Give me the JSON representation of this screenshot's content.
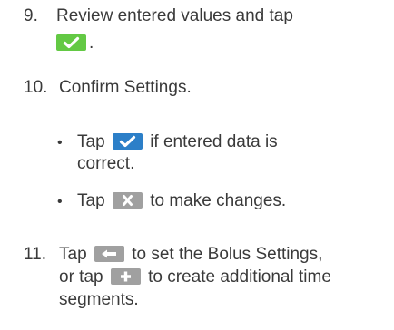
{
  "steps": [
    {
      "number": "9.",
      "line1": "Review entered values and tap",
      "after_icon": ".",
      "icon": "green-checkmark-icon"
    },
    {
      "number": "10.",
      "text": "Confirm Settings.",
      "bullets": [
        {
          "bullet": "•",
          "before_icon": "Tap",
          "icon": "blue-checkmark-icon",
          "after_icon": "if entered data is",
          "line2": "correct."
        },
        {
          "bullet": "•",
          "before_icon": "Tap",
          "icon": "gray-x-icon",
          "after_icon": "to make changes."
        }
      ]
    },
    {
      "number": "11.",
      "before_icon": "Tap",
      "icon": "back-arrow-icon",
      "after_icon": "to set the Bolus Settings,",
      "line2_before": "or tap",
      "line2_icon": "plus-icon",
      "line2_after": "to create additional time",
      "line3": "segments."
    }
  ],
  "colors": {
    "text": "#3a3a3a",
    "green_icon": "#63c944",
    "blue_icon": "#2c7fc8",
    "gray_icon": "#a0a0a0"
  }
}
